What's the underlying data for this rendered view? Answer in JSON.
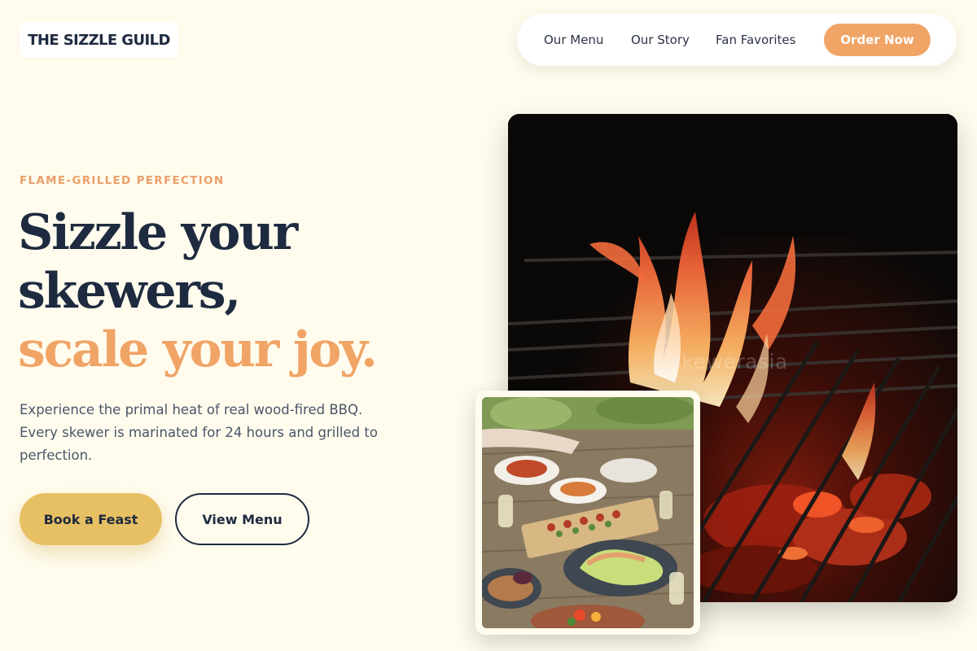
{
  "brand": {
    "name": "THE SIZZLE GUILD"
  },
  "nav": {
    "items": [
      "Our Menu",
      "Our Story",
      "Fan Favorites"
    ],
    "cta": "Order Now"
  },
  "hero": {
    "eyebrow": "FLAME-GRILLED PERFECTION",
    "headline_line1": "Sizzle your",
    "headline_line2": "skewers,",
    "headline_accent": "scale your joy.",
    "description": "Experience the primal heat of real wood-fired BBQ. Every skewer is marinated for 24 hours and grilled to perfection.",
    "primary_button": "Book a Feast",
    "secondary_button": "View Menu"
  },
  "images": {
    "main_photo": "grill-fire-photo",
    "watermark": "skewerasia",
    "secondary_photo": "outdoor-feast-table-photo"
  },
  "colors": {
    "background": "#fffcee",
    "navy": "#1e2a3f",
    "accent_orange": "#f0a466",
    "gold": "#e8c064"
  }
}
